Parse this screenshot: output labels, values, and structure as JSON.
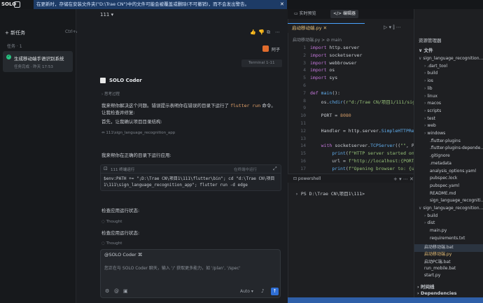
{
  "topbar": {
    "app_name": "SOLO",
    "notice": "在更新时，存储在安装文件夹(\"D:\\Trae CN\")中的文件可能会被覆盖或删除(不可撤销)，而不会发出警告。",
    "close": "✕"
  },
  "sidebar": {
    "new_task": "+  新任务",
    "new_task_shortcut": "Ctrl+Alt+N",
    "tasks_heading": "任务 · 1",
    "task": {
      "title": "生成移动端手语识别系统",
      "subtitle": "任务完成 · 昨天 17:53"
    }
  },
  "chat": {
    "header": "111",
    "user_name": "阿子",
    "terminal_chip": "Terminal 1-11",
    "agent_name": "SOLO Coder",
    "thought_1": "› 思考过程",
    "para_1_pre": "我来帮你解决这个问题。错误提示表明你在错误的目录下运行了 ",
    "para_1_code": "flutter run",
    "para_1_post": " 命令。让我检查并修复:",
    "para_2": "首先，让我确认项目目录结构:",
    "file_ref": "111\\sign_language_recognition_app",
    "para_3": "我来帮你在正确的目录下运行应用:",
    "cmd_label": "111   终端运行",
    "cmd_action": "在终端中运行",
    "cmd_text": "$env:PATH += \";D:\\Trae CN\\项目1\\111\\flutter\\bin\"; cd \"d:\\Trae CN\\项目1\\111\\sign_language_recognition_app\"; flutter run -d edge",
    "para_4": "检查应用运行状态:",
    "thought_2": "Thought",
    "para_5": "检查应用运行状态:",
    "thought_3": "Thought"
  },
  "input": {
    "agent": "@SOLO Coder ⌘",
    "placeholder": "您正在与 SOLO Coder 聊天，输入 '/' 获取更多能力，如 '/plan', '/spec'",
    "mode": "Auto ▾",
    "send": "↑"
  },
  "editor": {
    "btn_laptop": "▭ 实时预览",
    "btn_editor": "</> 编辑器",
    "file_tab": "启动移动端.py ✕",
    "breadcrumb": "启动移动端.py > ⊘ main",
    "code_lines": [
      {
        "n": "1",
        "html": "<span class='kw'>import</span> http.server"
      },
      {
        "n": "2",
        "html": "<span class='kw'>import</span> socketserver"
      },
      {
        "n": "3",
        "html": "<span class='kw'>import</span> webbrowser"
      },
      {
        "n": "4",
        "html": "<span class='kw'>import</span> os"
      },
      {
        "n": "5",
        "html": "<span class='kw'>import</span> sys"
      },
      {
        "n": "6",
        "html": ""
      },
      {
        "n": "7",
        "html": "<span class='kw'>def</span> <span class='fn'>main</span>():"
      },
      {
        "n": "8",
        "html": "    os.<span class='fn'>chdir</span>(<span class='st'>r\"d:/Trae CN/项目1/111/sign_la</span>"
      },
      {
        "n": "9",
        "html": ""
      },
      {
        "n": "10",
        "html": "    PORT = <span class='nm'>8080</span>"
      },
      {
        "n": "11",
        "html": ""
      },
      {
        "n": "12",
        "html": "    Handler = http.server.<span class='fn'>SimpleHTTPReq</span>"
      },
      {
        "n": "13",
        "html": ""
      },
      {
        "n": "14",
        "html": "    <span class='kw'>with</span> socketserver.<span class='fn'>TCPServer</span>((<span class='st'>\"\"</span>, PO"
      },
      {
        "n": "15",
        "html": "        <span class='fn'>print</span>(<span class='st'>f\"HTTP server started on</span>"
      },
      {
        "n": "16",
        "html": "        url = <span class='st'>f\"http://localhost:{PORT}</span>"
      },
      {
        "n": "17",
        "html": "        <span class='fn'>print</span>(<span class='st'>f\"Opening browser to: {ur</span>"
      }
    ],
    "terminal_tab": "⊡ powershell",
    "terminal_line": "PS D:\\Trae CN\\项目1\\111>"
  },
  "explorer": {
    "title": "资源管理器",
    "files_heading": "∨ 文件",
    "items": [
      {
        "label": "sign_language_recognition...",
        "caret": "∨",
        "indent": 0,
        "color": "#c9cdd3"
      },
      {
        "label": ".dart_tool",
        "caret": "›",
        "indent": 1,
        "color": "#c9cdd3"
      },
      {
        "label": "build",
        "caret": "›",
        "indent": 1,
        "color": "#c9cdd3"
      },
      {
        "label": "ios",
        "caret": "›",
        "indent": 1,
        "color": "#c9cdd3"
      },
      {
        "label": "lib",
        "caret": "›",
        "indent": 1,
        "color": "#c9cdd3"
      },
      {
        "label": "linux",
        "caret": "›",
        "indent": 1,
        "color": "#c9cdd3"
      },
      {
        "label": "macos",
        "caret": "›",
        "indent": 1,
        "color": "#c9cdd3"
      },
      {
        "label": "scripts",
        "caret": "›",
        "indent": 1,
        "color": "#c9cdd3"
      },
      {
        "label": "test",
        "caret": "›",
        "indent": 1,
        "color": "#c9cdd3"
      },
      {
        "label": "web",
        "caret": "›",
        "indent": 1,
        "color": "#c9cdd3"
      },
      {
        "label": "windows",
        "caret": "›",
        "indent": 1,
        "color": "#c9cdd3"
      },
      {
        "label": ".flutter-plugins",
        "caret": "",
        "indent": 2,
        "color": "#c9cdd3"
      },
      {
        "label": ".flutter-plugins-depende...",
        "caret": "",
        "indent": 2,
        "color": "#c9cdd3"
      },
      {
        "label": ".gitignore",
        "caret": "",
        "indent": 2,
        "color": "#c9cdd3"
      },
      {
        "label": ".metadata",
        "caret": "",
        "indent": 2,
        "color": "#c9cdd3"
      },
      {
        "label": "analysis_options.yaml",
        "caret": "",
        "indent": 2,
        "color": "#c9cdd3"
      },
      {
        "label": "pubspec.lock",
        "caret": "",
        "indent": 2,
        "color": "#c9cdd3"
      },
      {
        "label": "pubspec.yaml",
        "caret": "",
        "indent": 2,
        "color": "#c9cdd3"
      },
      {
        "label": "README.md",
        "caret": "",
        "indent": 2,
        "color": "#c9cdd3"
      },
      {
        "label": "sign_language_recogniti...",
        "caret": "",
        "indent": 2,
        "color": "#c9cdd3"
      },
      {
        "label": "sign_language_recognition...",
        "caret": "∨",
        "indent": 0,
        "color": "#c9cdd3"
      },
      {
        "label": "build",
        "caret": "›",
        "indent": 1,
        "color": "#c9cdd3"
      },
      {
        "label": "dist",
        "caret": "›",
        "indent": 1,
        "color": "#c9cdd3"
      },
      {
        "label": "main.py",
        "caret": "",
        "indent": 2,
        "color": "#c9cdd3"
      },
      {
        "label": "requirements.txt",
        "caret": "",
        "indent": 2,
        "color": "#c9cdd3"
      },
      {
        "label": "启动移动端.bat",
        "caret": "",
        "indent": 1,
        "color": "#c9cdd3"
      },
      {
        "label": "启动移动端.py",
        "caret": "",
        "indent": 1,
        "color": "#e6c07b"
      },
      {
        "label": "启动PC端.bat",
        "caret": "",
        "indent": 1,
        "color": "#c9cdd3"
      },
      {
        "label": "run_mobile.bat",
        "caret": "",
        "indent": 1,
        "color": "#c9cdd3"
      },
      {
        "label": "start.py",
        "caret": "",
        "indent": 1,
        "color": "#c9cdd3"
      }
    ],
    "timeline": "› 时间线",
    "dependencies": "› Dependencies"
  }
}
